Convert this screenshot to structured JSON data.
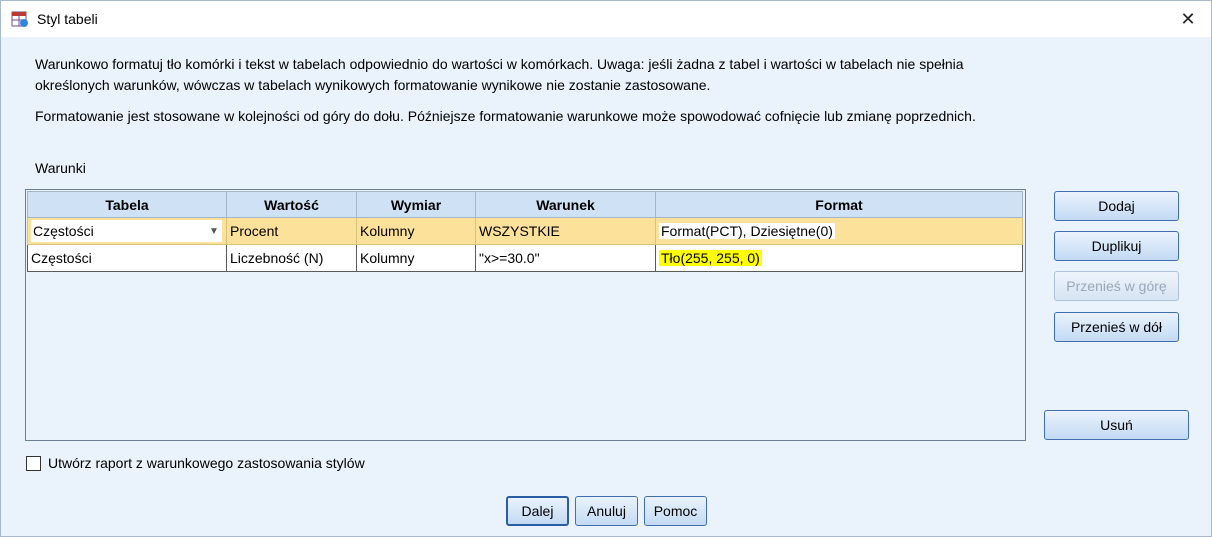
{
  "window": {
    "title": "Styl tabeli",
    "close_glyph": "✕"
  },
  "description": {
    "p1": "Warunkowo formatuj tło komórki i tekst w tabelach odpowiednio do wartości w komórkach. Uwaga: jeśli żadna z tabel i wartości w tabelach nie spełnia określonych warunków, wówczas w tabelach wynikowych formatowanie wynikowe nie zostanie zastosowane.",
    "p2": "Formatowanie jest stosowane w kolejności od góry do dołu. Późniejsze formatowanie warunkowe może spowodować cofnięcie lub zmianę poprzednich."
  },
  "conditions": {
    "label": "Warunki",
    "columns": [
      "Tabela",
      "Wartość",
      "Wymiar",
      "Warunek",
      "Format"
    ],
    "rows": [
      {
        "tabela": "Częstości",
        "wartosc": "Procent",
        "wymiar": "Kolumny",
        "warunek": "WSZYSTKIE",
        "format": "Format(PCT), Dziesiętne(0)"
      },
      {
        "tabela": "Częstości",
        "wartosc": "Liczebność (N)",
        "wymiar": "Kolumny",
        "warunek": "\"x>=30.0\"",
        "format": "Tło(255, 255, 0)"
      }
    ]
  },
  "buttons": {
    "dodaj": "Dodaj",
    "duplikuj": "Duplikuj",
    "w_gore": "Przenieś w górę",
    "w_dol": "Przenieś w dół",
    "usun": "Usuń",
    "dalej": "Dalej",
    "anuluj": "Anuluj",
    "pomoc": "Pomoc"
  },
  "checkbox": {
    "label": "Utwórz raport z warunkowego zastosowania stylów",
    "checked": false
  },
  "colors": {
    "background": "#eaf2fb",
    "selected_row": "#fbe19a",
    "highlight": "#ffff00"
  }
}
